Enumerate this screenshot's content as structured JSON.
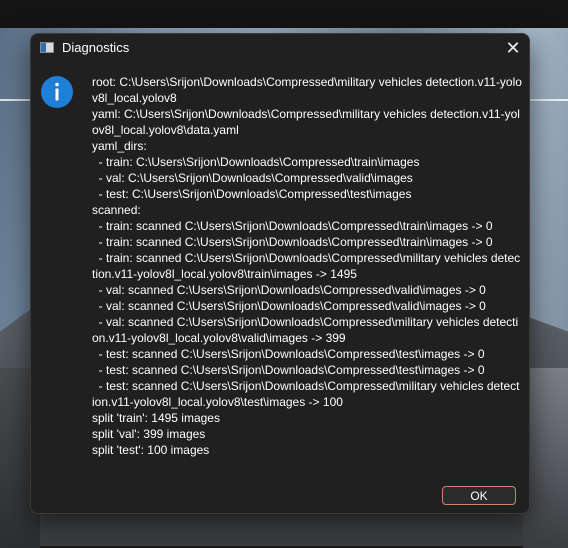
{
  "dialog": {
    "title": "Diagnostics",
    "close_label": "✕",
    "icon": "info-icon",
    "accent_color": "#1e7fd6",
    "ok_border_color": "#d2836a",
    "message": "root: C:\\Users\\Srijon\\Downloads\\Compressed\\military vehicles detection.v11-yolov8l_local.yolov8\nyaml: C:\\Users\\Srijon\\Downloads\\Compressed\\military vehicles detection.v11-yolov8l_local.yolov8\\data.yaml\nyaml_dirs:\n  - train: C:\\Users\\Srijon\\Downloads\\Compressed\\train\\images\n  - val: C:\\Users\\Srijon\\Downloads\\Compressed\\valid\\images\n  - test: C:\\Users\\Srijon\\Downloads\\Compressed\\test\\images\nscanned:\n  - train: scanned C:\\Users\\Srijon\\Downloads\\Compressed\\train\\images -> 0\n  - train: scanned C:\\Users\\Srijon\\Downloads\\Compressed\\train\\images -> 0\n  - train: scanned C:\\Users\\Srijon\\Downloads\\Compressed\\military vehicles detection.v11-yolov8l_local.yolov8\\train\\images -> 1495\n  - val: scanned C:\\Users\\Srijon\\Downloads\\Compressed\\valid\\images -> 0\n  - val: scanned C:\\Users\\Srijon\\Downloads\\Compressed\\valid\\images -> 0\n  - val: scanned C:\\Users\\Srijon\\Downloads\\Compressed\\military vehicles detection.v11-yolov8l_local.yolov8\\valid\\images -> 399\n  - test: scanned C:\\Users\\Srijon\\Downloads\\Compressed\\test\\images -> 0\n  - test: scanned C:\\Users\\Srijon\\Downloads\\Compressed\\test\\images -> 0\n  - test: scanned C:\\Users\\Srijon\\Downloads\\Compressed\\military vehicles detection.v11-yolov8l_local.yolov8\\test\\images -> 100\nsplit 'train': 1495 images\nsplit 'val': 399 images\nsplit 'test': 100 images",
    "ok_label": "OK"
  }
}
